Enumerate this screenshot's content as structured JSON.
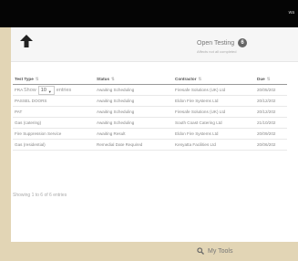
{
  "topbar": {
    "user": "wa"
  },
  "header": {
    "open_testing_label": "Open Testing",
    "open_testing_count": "6",
    "open_testing_sub": "Affects not all completed"
  },
  "controls": {
    "show_label": "Show",
    "page_size": "10",
    "entries_label": "entries"
  },
  "table": {
    "columns": [
      "Test Type",
      "Status",
      "Contractor",
      "Due"
    ],
    "rows": [
      [
        "FRA",
        "Awaiting Scheduling",
        "Firesafe Solutions (UK) Ltd",
        "20/05/202"
      ],
      [
        "PASSEL DOORS",
        "Awaiting Scheduling",
        "Eldon Fire Systems Ltd",
        "20/12/202"
      ],
      [
        "PAT",
        "Awaiting Scheduling",
        "Firesafe Solutions (UK) Ltd",
        "20/12/202"
      ],
      [
        "Gas (catering)",
        "Awaiting Scheduling",
        "South Coast Catering Ltd",
        "21/10/202"
      ],
      [
        "Fire Suppression Service",
        "Awaiting Result",
        "Eldon Fire Systems Ltd",
        "20/09/202"
      ],
      [
        "Gas (residential)",
        "Remedial Date Required",
        "Kenyatta Facilities Ltd",
        "20/06/202"
      ]
    ]
  },
  "info": "Showing 1 to 6 of 6 entries",
  "footer": {
    "my_tools_label": "My Tools"
  }
}
